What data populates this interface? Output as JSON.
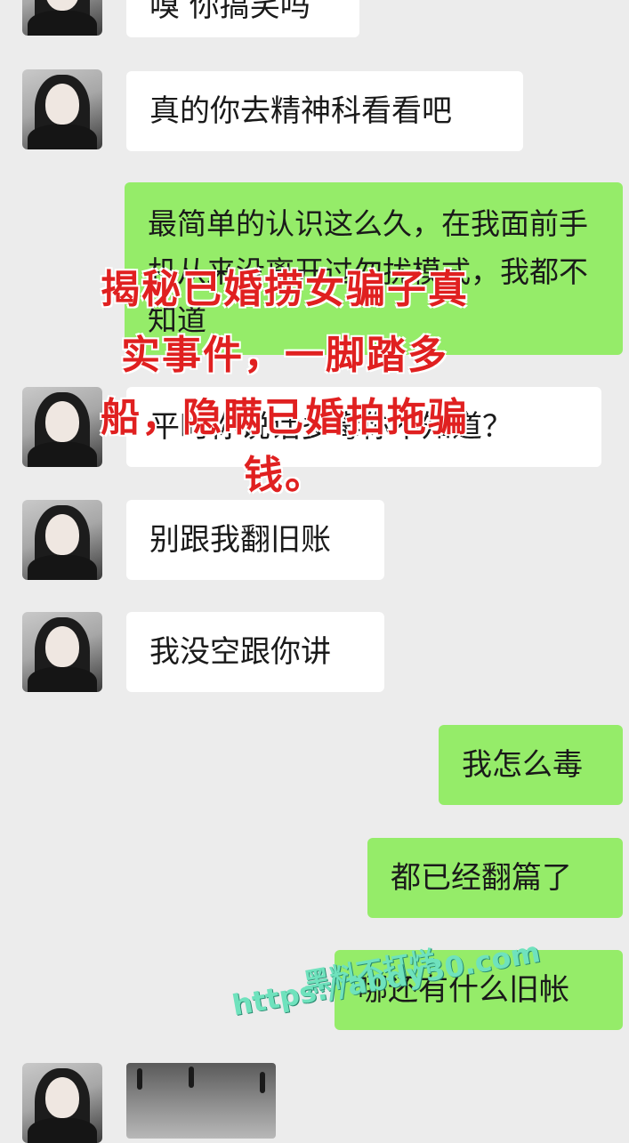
{
  "messages": [
    {
      "side": "left",
      "text": "嗅 你搞笑吗"
    },
    {
      "side": "left",
      "text": "真的你去精神科看看吧"
    },
    {
      "side": "right",
      "text": "最简单的认识这么久，在我面前手机从来没离开过勿扰模式，我都不知道"
    },
    {
      "side": "left",
      "text": "平时你说话多毒你不知道？"
    },
    {
      "side": "left",
      "text": "别跟我翻旧账"
    },
    {
      "side": "left",
      "text": "我没空跟你讲"
    },
    {
      "side": "right",
      "text": "我怎么毒"
    },
    {
      "side": "right",
      "text": "都已经翻篇了"
    },
    {
      "side": "right",
      "text": "哪还有什么旧帐"
    }
  ],
  "overlay": {
    "line1": "揭秘已婚捞女骗子真",
    "line2": "实事件，一脚踏多",
    "line3": "船，隐瞒已婚拍拖骗",
    "line4": "钱。"
  },
  "watermark": {
    "line1": "黑料不打烊",
    "line2": "https://abdy30.com"
  },
  "colors": {
    "background": "#ececec",
    "bubble_me": "#95ec69",
    "bubble_other": "#ffffff",
    "overlay_text": "#e02020",
    "watermark": "#6fe2bd"
  }
}
